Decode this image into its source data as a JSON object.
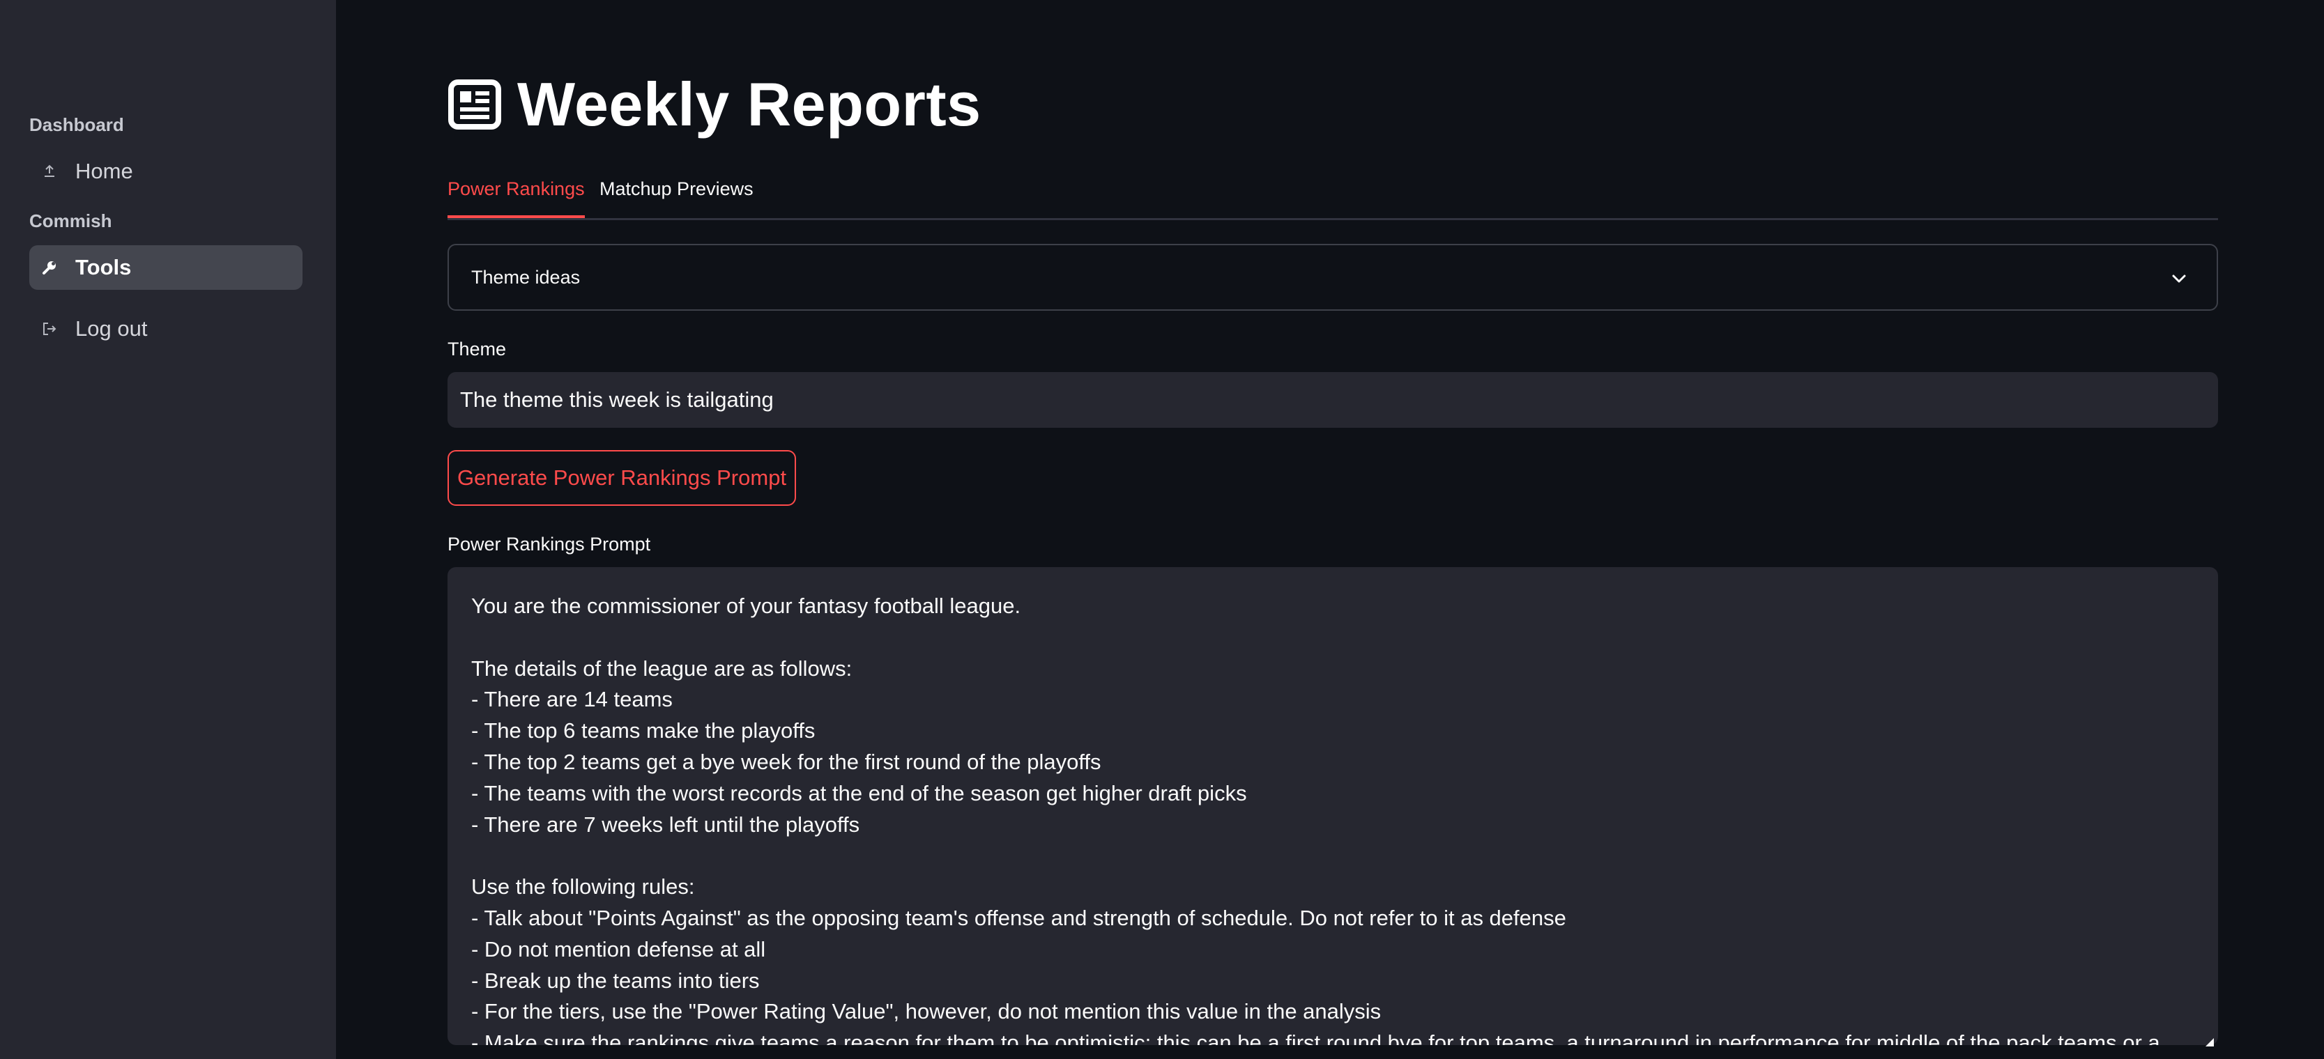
{
  "sidebar": {
    "sections": [
      {
        "header": "Dashboard",
        "items": [
          {
            "label": "Home",
            "icon": "upload-icon",
            "active": false
          }
        ]
      },
      {
        "header": "Commish",
        "items": [
          {
            "label": "Tools",
            "icon": "wrench-icon",
            "active": true
          }
        ]
      }
    ],
    "logout": {
      "label": "Log out",
      "icon": "logout-icon"
    }
  },
  "main": {
    "title": "Weekly Reports",
    "title_icon": "newspaper-icon",
    "tabs": [
      {
        "label": "Power Rankings",
        "active": true
      },
      {
        "label": "Matchup Previews",
        "active": false
      }
    ],
    "expander": {
      "label": "Theme ideas",
      "expanded": false
    },
    "theme": {
      "label": "Theme",
      "value": "The theme this week is tailgating"
    },
    "generate_button": {
      "label": "Generate Power Rankings Prompt"
    },
    "prompt": {
      "label": "Power Rankings Prompt",
      "value": "You are the commissioner of your fantasy football league.\n\nThe details of the league are as follows:\n- There are 14 teams\n- The top 6 teams make the playoffs\n- The top 2 teams get a bye week for the first round of the playoffs\n- The teams with the worst records at the end of the season get higher draft picks\n- There are 7 weeks left until the playoffs\n\nUse the following rules:\n- Talk about \"Points Against\" as the opposing team's offense and strength of schedule. Do not refer to it as defense\n- Do not mention defense at all\n- Break up the teams into tiers\n- For the tiers, use the \"Power Rating Value\", however, do not mention this value in the analysis\n- Make sure the rankings give teams a reason for them to be optimistic; this can be a first round bye for top teams, a turnaround in performance for middle of the pack teams or a high"
    }
  },
  "colors": {
    "accent": "#ff4b4b",
    "background": "#0e1117",
    "sidebar": "#262730",
    "input_bg": "#262730"
  }
}
